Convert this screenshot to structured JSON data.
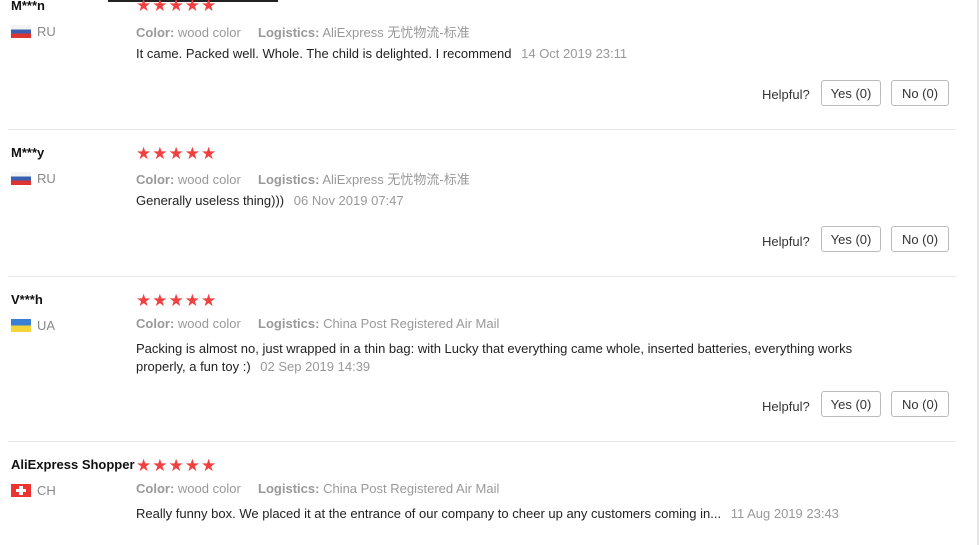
{
  "labels": {
    "color": "Color:",
    "logistics": "Logistics:",
    "helpful": "Helpful?"
  },
  "stars_glyphs": "★★★★★",
  "reviews": [
    {
      "user": "M***n",
      "country": "RU",
      "flag": "russia-flag-icon",
      "rating": 5,
      "color": "wood color",
      "logistics": "AliExpress 无忧物流-标准",
      "text": "It came. Packed well. Whole. The child is delighted. I recommend",
      "date": "14 Oct 2019 23:11",
      "yes": "Yes (0)",
      "no": "No (0)"
    },
    {
      "user": "M***y",
      "country": "RU",
      "flag": "russia-flag-icon",
      "rating": 5,
      "color": "wood color",
      "logistics": "AliExpress 无忧物流-标准",
      "text": "Generally useless thing)))",
      "date": "06 Nov 2019 07:47",
      "yes": "Yes (0)",
      "no": "No (0)"
    },
    {
      "user": "V***h",
      "country": "UA",
      "flag": "ukraine-flag-icon",
      "rating": 5,
      "color": "wood color",
      "logistics": "China Post Registered Air Mail",
      "text": "Packing is almost no, just wrapped in a thin bag: with Lucky that everything came whole, inserted batteries, everything works properly, a fun toy :)",
      "date": "02 Sep 2019 14:39",
      "yes": "Yes (0)",
      "no": "No (0)"
    },
    {
      "user": "AliExpress Shopper",
      "country": "CH",
      "flag": "switzerland-flag-icon",
      "rating": 5,
      "color": "wood color",
      "logistics": "China Post Registered Air Mail",
      "text": "Really funny box. We placed it at the entrance of our company to cheer up any customers coming in...",
      "date": "11 Aug 2019 23:43"
    }
  ]
}
